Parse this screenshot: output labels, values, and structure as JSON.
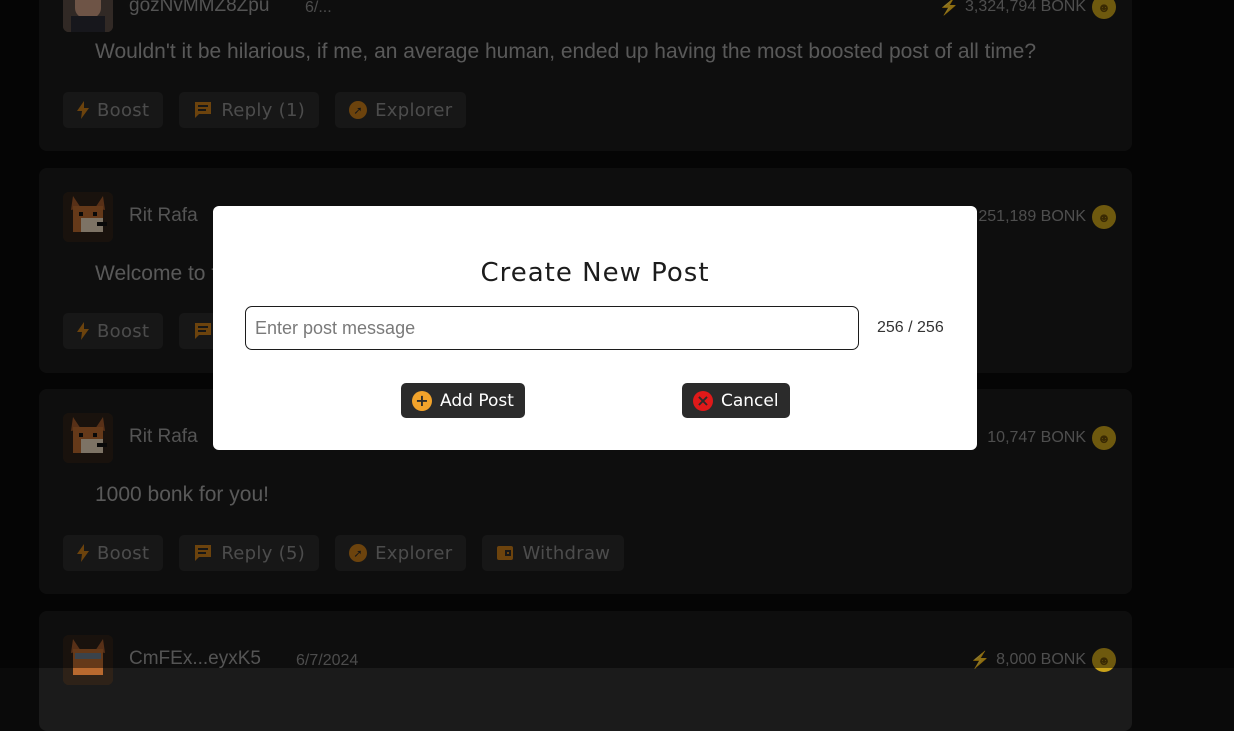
{
  "posts": [
    {
      "username": "gozNvMMZ8Zpu",
      "date": "6/...",
      "bonk": "3,324,794 BONK",
      "text": "Wouldn't it be hilarious, if me, an average human, ended up having the most boosted post of all time?",
      "actions": [
        "Boost",
        "Reply (1)",
        "Explorer"
      ]
    },
    {
      "username": "Rit Rafa",
      "bonk": "251,189 BONK",
      "text": "Welcome to t",
      "actions": [
        "Boost",
        ""
      ]
    },
    {
      "username": "Rit Rafa",
      "bonk": "10,747 BONK",
      "text": "1000 bonk for you!",
      "actions": [
        "Boost",
        "Reply (5)",
        "Explorer",
        "Withdraw"
      ]
    },
    {
      "username": "CmFEx...eyxK5",
      "date": "6/7/2024",
      "bonk": "8,000 BONK"
    }
  ],
  "modal": {
    "title": "Create New Post",
    "input_placeholder": "Enter post message",
    "input_value": "",
    "char_count": "256 / 256",
    "add_label": "Add Post",
    "cancel_label": "Cancel"
  },
  "icons": {
    "boost": "lightning-bolt-icon",
    "reply": "chat-bubble-icon",
    "explorer": "compass-icon",
    "withdraw": "wallet-icon",
    "add": "plus-circle-icon",
    "cancel": "x-circle-icon",
    "coin": "bonk-coin-icon"
  },
  "colors": {
    "accent": "#c57a18",
    "bolt": "#d4601a",
    "coin": "#c9a21a",
    "cancel": "#e01919",
    "add": "#f2a32b"
  }
}
